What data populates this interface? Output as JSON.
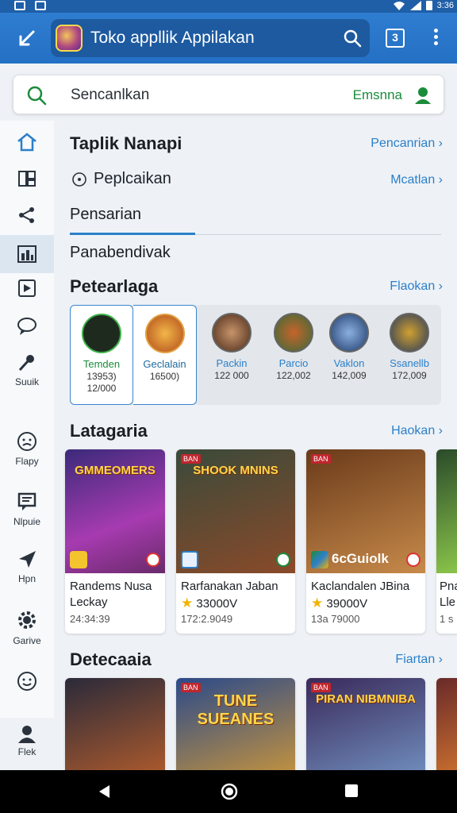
{
  "status": {
    "clock": "3:36"
  },
  "appbar": {
    "title": "Toko appllik Appilakan",
    "tabs_count": "3"
  },
  "search": {
    "placeholder": "Sencanlkan",
    "right_label": "Emsnna"
  },
  "rail": {
    "items": [
      {
        "label": "",
        "icon": "home-icon"
      },
      {
        "label": "",
        "icon": "apps-icon"
      },
      {
        "label": "",
        "icon": "share-icon"
      },
      {
        "label": "",
        "icon": "chart-icon"
      },
      {
        "label": "",
        "icon": "media-icon"
      },
      {
        "label": "",
        "icon": "chat-icon"
      },
      {
        "label": "Suuik",
        "icon": "pin-icon"
      },
      {
        "label": "Flapy",
        "icon": "emoji-icon"
      },
      {
        "label": "Nlpuie",
        "icon": "message-icon"
      },
      {
        "label": "Hpn",
        "icon": "send-icon"
      },
      {
        "label": "Garive",
        "icon": "gear-icon"
      },
      {
        "label": "",
        "icon": "smile-icon"
      },
      {
        "label": "Flek",
        "icon": "person-icon"
      }
    ]
  },
  "sections": {
    "top": {
      "title": "Taplik Nanapi",
      "link": "Pencanrian"
    },
    "apps": {
      "title": "Peplcaikan",
      "link": "Mcatlan"
    },
    "tab1": "Pensarian",
    "tab2": "Panabendivak",
    "ranking": {
      "title": "Petearlaga",
      "link": "Flaokan"
    },
    "latest": {
      "title": "Latagaria",
      "link": "Haokan"
    },
    "detect": {
      "title": "Detecaaia",
      "link": "Fiartan"
    }
  },
  "ranking": [
    {
      "name": "Temden",
      "v1": "13953)",
      "v2": "12/000",
      "color": "#3b4a3a"
    },
    {
      "name": "Geclalain",
      "v1": "16500)",
      "v2": "",
      "color": "#d77a26"
    },
    {
      "name": "Packin",
      "v1": "122 000",
      "v2": "",
      "color": "#6b4a3a"
    },
    {
      "name": "Parcio",
      "v1": "122,002",
      "v2": "",
      "color": "#4c8a4a"
    },
    {
      "name": "Vaklon",
      "v1": "142,009",
      "v2": "",
      "color": "#2e5a98"
    },
    {
      "name": "Ssanellb",
      "v1": "172,009",
      "v2": "",
      "color": "#2b3b5a"
    }
  ],
  "latest_cards": [
    {
      "art_caption": "GMMEOMERS",
      "title1": "Randems Nusa",
      "title2": "Leckay",
      "rating": "",
      "meta": "24:34:39",
      "bg1": "#3b2a7a",
      "bg2": "#a63bb0"
    },
    {
      "art_caption": "SHOOK MNINS",
      "tag": "BAN",
      "title1": "Rarfanakan Jaban",
      "title2": "",
      "rating": "33000V",
      "meta": "172:2.9049",
      "bg1": "#3a4a3a",
      "bg2": "#8a4a2a"
    },
    {
      "art_caption": "",
      "tag": "BAN",
      "overlay": "6cGuiolk",
      "title1": "Kaclandalen JBina",
      "title2": "",
      "rating": "39000V",
      "meta": "13a 79000",
      "bg1": "#6a3a1a",
      "bg2": "#c78a4a"
    },
    {
      "art_caption": "",
      "title1": "Pna",
      "title2": "Lle",
      "rating": "",
      "meta": "1 s",
      "bg1": "#2a4a2a",
      "bg2": "#8ac44a"
    }
  ],
  "detect_cards": [
    {
      "art_caption": "",
      "bg1": "#2a2a3a",
      "bg2": "#c7642a"
    },
    {
      "art_caption": "TUNE SUEANES",
      "tag": "BAN",
      "bg1": "#2b4a8a",
      "bg2": "#e0a030"
    },
    {
      "art_caption": "PIRAN NIBMNIBA",
      "tag": "BAN",
      "bg1": "#3a2a5a",
      "bg2": "#7aa0d0"
    },
    {
      "art_caption": "",
      "bg1": "#6a2a2a",
      "bg2": "#e08030"
    }
  ]
}
